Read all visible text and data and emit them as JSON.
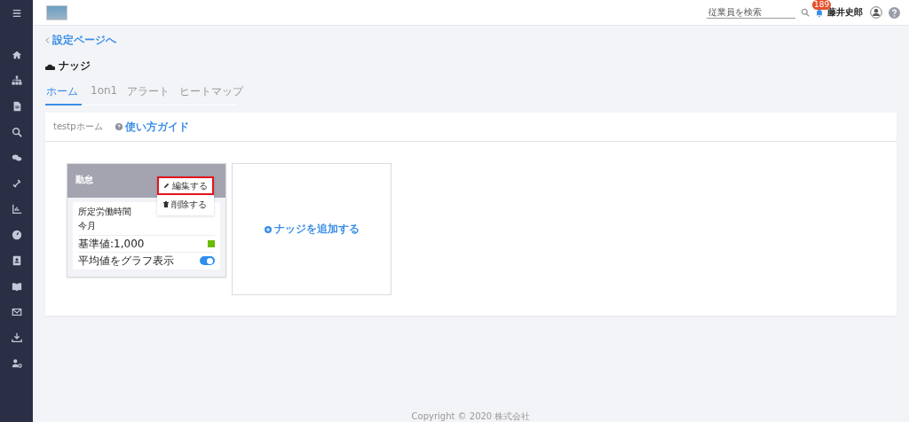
{
  "topbar": {
    "search": {
      "placeholder": "従業員を検索"
    },
    "notification_count": "189",
    "user_name": "藤井史郎"
  },
  "breadcrumb": "設定ページへ",
  "page_title": "ナッジ",
  "tabs": [
    {
      "label": "ホーム",
      "selected": true
    },
    {
      "label": "1on1",
      "selected": false
    },
    {
      "label": "アラート",
      "selected": false
    },
    {
      "label": "ヒートマップ",
      "selected": false
    }
  ],
  "panel": {
    "title": "testpホーム",
    "guide_link": "使い方ガイド",
    "nudge_card": {
      "title": "勤怠",
      "menu": [
        {
          "label": "編集する",
          "kind": "edit",
          "highlighted": true
        },
        {
          "label": "削除する",
          "kind": "delete",
          "highlighted": false
        }
      ],
      "metric": "所定労働時間",
      "period": "今月",
      "baseline": "基準値:1,000",
      "toggle": {
        "label": "平均値をグラフ表示",
        "on": true
      }
    },
    "add_card": "ナッジを追加する"
  },
  "footer": "Copyright © 2020 株式会社"
}
